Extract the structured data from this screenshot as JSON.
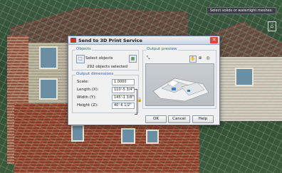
{
  "viewport": {
    "status_tip": "Select solids or watertight meshes:"
  },
  "dialog": {
    "title": "Send to 3D Print Service",
    "objects": {
      "legend": "Objects",
      "select_label": "Select objects",
      "selected_count": "292 objects selected"
    },
    "dimensions": {
      "legend": "Output dimensions",
      "rows": [
        {
          "label": "Scale:",
          "value": "1.0000"
        },
        {
          "label": "Length (X):",
          "value": "110'-5 3/4\""
        },
        {
          "label": "Width (Y):",
          "value": "145'-1 3/8\""
        },
        {
          "label": "Height (Z):",
          "value": "40'-6 1/2\""
        }
      ]
    },
    "preview": {
      "legend": "Output preview"
    },
    "buttons": {
      "ok": "OK",
      "cancel": "Cancel",
      "help": "Help"
    }
  },
  "colors": {
    "accent": "#2b5fb3",
    "close": "#d9473a"
  }
}
